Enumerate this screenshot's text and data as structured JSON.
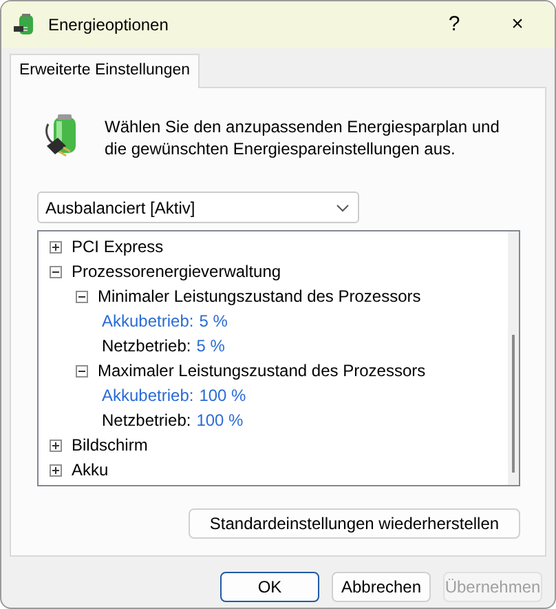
{
  "window": {
    "title": "Energieoptionen",
    "help": "?",
    "close": "×"
  },
  "tabs": [
    {
      "label": "Erweiterte Einstellungen",
      "selected": true
    }
  ],
  "description": "Wählen Sie den anzupassenden Energiesparplan und die gewünschten Energiespareinstellungen aus.",
  "plan": {
    "value": "Ausbalanciert [Aktiv]"
  },
  "tree": [
    {
      "label": "PCI Express",
      "expanded": false
    },
    {
      "label": "Prozessorenergieverwaltung",
      "expanded": true,
      "children": [
        {
          "label": "Minimaler Leistungszustand des Prozessors",
          "expanded": true,
          "children": [
            {
              "label": "Akkubetrieb:",
              "value": "5 %",
              "selected": true
            },
            {
              "label": "Netzbetrieb:",
              "value": "5 %",
              "selected": false
            }
          ]
        },
        {
          "label": "Maximaler Leistungszustand des Prozessors",
          "expanded": true,
          "children": [
            {
              "label": "Akkubetrieb:",
              "value": "100 %",
              "selected": true
            },
            {
              "label": "Netzbetrieb:",
              "value": "100 %",
              "selected": false
            }
          ]
        }
      ]
    },
    {
      "label": "Bildschirm",
      "expanded": false
    },
    {
      "label": "Akku",
      "expanded": false
    }
  ],
  "restore_button": "Standardeinstellungen wiederherstellen",
  "buttons": [
    {
      "label": "OK",
      "disabled": false,
      "default": true
    },
    {
      "label": "Abbrechen",
      "disabled": false,
      "default": false
    },
    {
      "label": "Übernehmen",
      "disabled": true,
      "default": false
    }
  ]
}
